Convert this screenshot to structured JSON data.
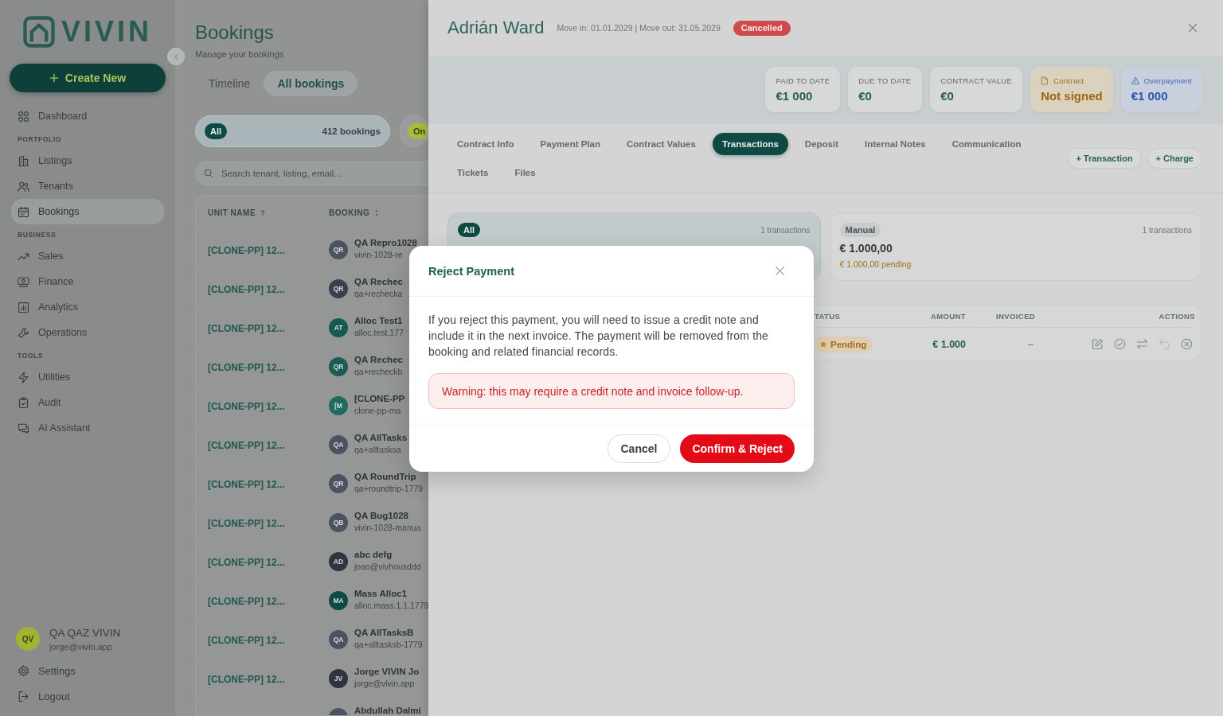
{
  "sidebar": {
    "logo": "VIVIN",
    "create_button": "Create New",
    "sections": [
      {
        "items": [
          {
            "label": "Dashboard",
            "selected": false
          }
        ]
      },
      {
        "heading": "PORTFOLIO",
        "items": [
          {
            "label": "Listings",
            "selected": false
          },
          {
            "label": "Tenants",
            "selected": false
          },
          {
            "label": "Bookings",
            "selected": true
          }
        ]
      },
      {
        "heading": "BUSINESS",
        "items": [
          {
            "label": "Sales",
            "selected": false
          },
          {
            "label": "Finance",
            "selected": false
          },
          {
            "label": "Analytics",
            "selected": false
          },
          {
            "label": "Operations",
            "selected": false
          }
        ]
      },
      {
        "heading": "TOOLS",
        "items": [
          {
            "label": "Utilities",
            "selected": false
          },
          {
            "label": "Audit",
            "selected": false
          },
          {
            "label": "AI Assistant",
            "selected": false
          }
        ]
      }
    ],
    "user": {
      "initials": "QV",
      "name": "QA QAZ VIVIN",
      "email": "jorge@vivin.app"
    },
    "footer_items": [
      {
        "label": "Settings"
      },
      {
        "label": "Logout"
      }
    ]
  },
  "bookings": {
    "title": "Bookings",
    "subtitle": "Manage your bookings",
    "view_tabs": [
      {
        "label": "Timeline",
        "selected": false
      },
      {
        "label": "All bookings",
        "selected": true
      }
    ],
    "filters": [
      {
        "label": "All",
        "count": "412 bookings",
        "color": "#0f4a42",
        "selected": true
      },
      {
        "label": "On",
        "color": "#a9bb3e",
        "selected": false
      }
    ],
    "search": {
      "placeholder": "Search tenant, listing, email..."
    },
    "table": {
      "columns": [
        {
          "label": "UNIT NAME",
          "sorted": true
        },
        {
          "label": "BOOKING",
          "sorted": false
        }
      ],
      "rows": [
        {
          "unit": "[CLONE-PP] 12...",
          "initials": "QR",
          "color": "#4c5360",
          "name": "QA Repro1028",
          "email": "vivin-1028-re"
        },
        {
          "unit": "[CLONE-PP] 12...",
          "initials": "QR",
          "color": "#3a404c",
          "name": "QA Rechec",
          "email": "qa+rechecka"
        },
        {
          "unit": "[CLONE-PP] 12...",
          "initials": "AT",
          "color": "#135a50",
          "name": "Alloc Test1",
          "email": "alloc.test.177"
        },
        {
          "unit": "[CLONE-PP] 12...",
          "initials": "QR",
          "color": "#1a5d54",
          "name": "QA Rechec",
          "email": "qa+recheckb"
        },
        {
          "unit": "[CLONE-PP] 12...",
          "initials": "[M",
          "color": "#1f6b61",
          "name": "[CLONE-PP",
          "email": "clone-pp-ma"
        },
        {
          "unit": "[CLONE-PP] 12...",
          "initials": "QA",
          "color": "#4c5360",
          "name": "QA AllTasks",
          "email": "qa+alltasksa"
        },
        {
          "unit": "[CLONE-PP] 12...",
          "initials": "QR",
          "color": "#4c5360",
          "name": "QA RoundTrip",
          "email": "qa+roundtrip-1779"
        },
        {
          "unit": "[CLONE-PP] 12...",
          "initials": "QB",
          "color": "#4c5360",
          "name": "QA Bug1028",
          "email": "vivin-1028-manua"
        },
        {
          "unit": "[CLONE-PP] 12...",
          "initials": "AD",
          "color": "#2f343e",
          "name": "abc defg",
          "email": "joao@vivhousddd"
        },
        {
          "unit": "[CLONE-PP] 12...",
          "initials": "MA",
          "color": "#0e4a43",
          "name": "Mass Alloc1",
          "email": "alloc.mass.1.1.1779"
        },
        {
          "unit": "[CLONE-PP] 12...",
          "initials": "QA",
          "color": "#4c5360",
          "name": "QA AllTasksB",
          "email": "qa+alltasksb-1779"
        },
        {
          "unit": "[CLONE-PP] 12...",
          "initials": "JV",
          "color": "#2f343e",
          "name": "Jorge VIVIN Jo",
          "email": "jorge@vivin.app"
        },
        {
          "color": "#4c5360",
          "name": "Abdullah Dalmi"
        }
      ]
    }
  },
  "drawer": {
    "title": "Adrián Ward",
    "dates": "Move in: 01.01.2029 | Move out: 31.05.2029",
    "status": {
      "label": "Cancelled",
      "kind": "cancelled"
    },
    "stats": [
      {
        "label": "PAID TO DATE",
        "value": "€1 000",
        "kind": "plain"
      },
      {
        "label": "DUE TO DATE",
        "value": "€0",
        "kind": "plain"
      },
      {
        "label": "CONTRACT VALUE",
        "value": "€0",
        "kind": "plain"
      },
      {
        "label": "Contract",
        "value": "Not signed",
        "kind": "warning"
      },
      {
        "label": "Overpayment",
        "value": "€1 000",
        "kind": "info"
      }
    ],
    "tabs": [
      {
        "label": "Contract Info",
        "selected": false
      },
      {
        "label": "Payment Plan",
        "selected": false
      },
      {
        "label": "Contract Values",
        "selected": false
      },
      {
        "label": "Transactions",
        "selected": true
      },
      {
        "label": "Deposit",
        "selected": false
      },
      {
        "label": "Internal Notes",
        "selected": false
      },
      {
        "label": "Communication",
        "selected": false
      },
      {
        "label": "Tickets",
        "selected": false
      },
      {
        "label": "Files",
        "selected": false
      }
    ],
    "actions": [
      "+ Transaction",
      "+ Charge"
    ],
    "summary_cards": [
      {
        "label": "All",
        "count": "1 transactions",
        "selected": true
      },
      {
        "label": "Manual",
        "count": "1 transactions",
        "amount": "€ 1.000,00",
        "pending": "€ 1.000,00 pending",
        "selected": false
      }
    ],
    "transactions": {
      "columns": [
        "TATUS",
        "AMOUNT",
        "INVOICED",
        "ACTIONS"
      ],
      "rows": [
        {
          "status": {
            "label": "Pending",
            "kind": "pending"
          },
          "amount": "€ 1.000",
          "invoiced": "–",
          "actions": [
            {
              "disabled": false
            },
            {
              "disabled": false
            },
            {
              "disabled": false
            },
            {
              "disabled": true
            },
            {
              "disabled": false
            }
          ]
        }
      ]
    }
  },
  "modal": {
    "title": "Reject Payment",
    "message": "If you reject this payment, you will need to issue a credit note and include it in the next invoice. The payment will be removed from the booking and related financial records.",
    "warning": "Warning: this may require a credit note and invoice follow-up.",
    "buttons": [
      {
        "label": "Cancel",
        "kind": "secondary"
      },
      {
        "label": "Confirm & Reject",
        "kind": "danger"
      }
    ]
  }
}
